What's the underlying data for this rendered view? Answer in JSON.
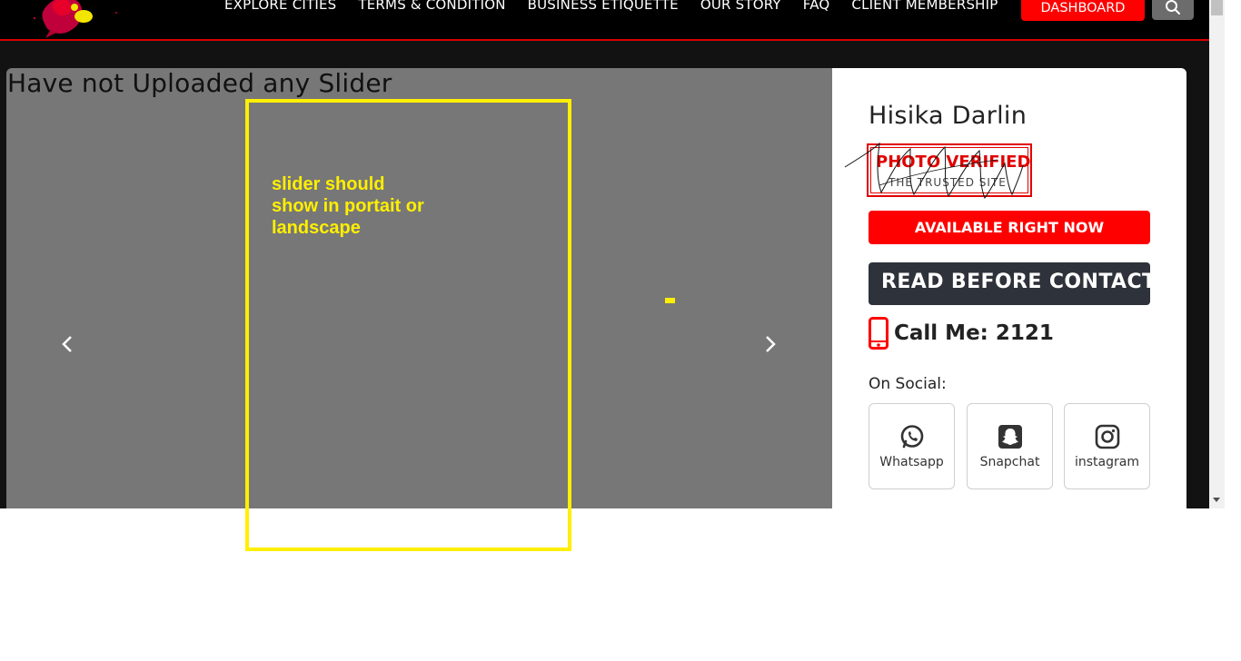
{
  "nav": {
    "items": [
      "EXPLORE CITIES",
      "TERMS & CONDITION",
      "BUSINESS ETIQUETTE",
      "OUR STORY",
      "FAQ",
      "CLIENT MEMBERSHIP"
    ],
    "dashboard_label": "DASHBOARD",
    "search_icon": "search-icon"
  },
  "slider": {
    "heading": "Have not Uploaded any Slider",
    "prev_icon": "chevron-left-icon",
    "next_icon": "chevron-right-icon"
  },
  "profile": {
    "name": "Hisika Darlin",
    "verified_title": "PHOTO VERIFIED",
    "verified_sub": "THE TRUSTED SITE",
    "available_label": "AVAILABLE RIGHT NOW",
    "read_label": "READ BEFORE CONTACTING",
    "call_label": "Call Me: 2121",
    "social_label": "On Social:",
    "socials": [
      {
        "label": "Whatsapp",
        "icon": "whatsapp-icon"
      },
      {
        "label": "Snapchat",
        "icon": "snapchat-icon"
      },
      {
        "label": "instagram",
        "icon": "instagram-icon"
      }
    ]
  },
  "annotation": {
    "note": "slider should\nshow in portait or\nlandscape"
  },
  "colors": {
    "brand_red": "#ff0000",
    "nav_bg": "#000000",
    "slider_bg": "#777777",
    "annotation_yellow": "#ffef00",
    "read_btn_bg": "#2e323a"
  }
}
